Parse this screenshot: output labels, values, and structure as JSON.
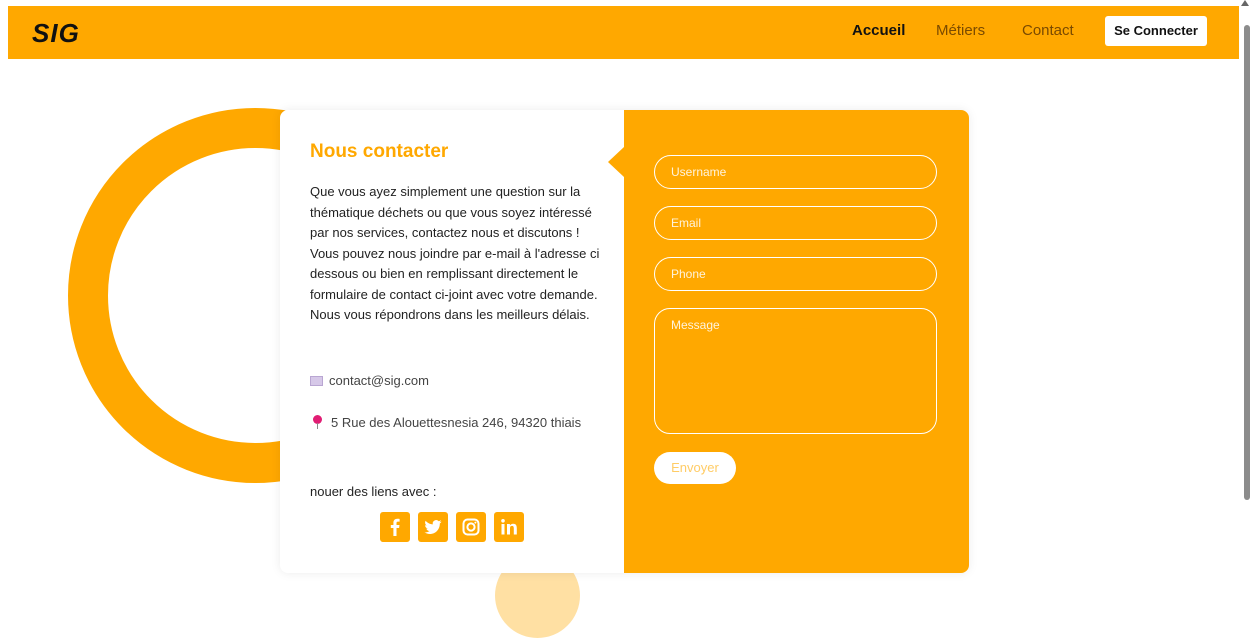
{
  "header": {
    "logo": "SIG",
    "nav": [
      {
        "label": "Accueil"
      },
      {
        "label": "Métiers"
      },
      {
        "label": "Contact"
      }
    ],
    "login_label": "Se Connecter"
  },
  "contact": {
    "title": "Nous contacter",
    "description": "Que vous ayez simplement une question sur la thématique déchets ou que vous soyez intéressé par nos services, contactez nous et discutons ! Vous pouvez nous joindre par e-mail à l'adresse ci dessous ou bien en remplissant directement le formulaire de contact ci-joint avec votre demande. Nous vous répondrons dans les meilleurs délais.",
    "email": "contact@sig.com",
    "address": "5 Rue des Alouettesnesia 246, 94320 thiais",
    "social_label": "nouer des liens avec :",
    "social_icons": [
      "facebook-icon",
      "twitter-icon",
      "instagram-icon",
      "linkedin-icon"
    ]
  },
  "form": {
    "username_placeholder": "Username",
    "email_placeholder": "Email",
    "phone_placeholder": "Phone",
    "message_placeholder": "Message",
    "submit_label": "Envoyer"
  },
  "colors": {
    "accent": "#ffa800",
    "background": "#ffffff"
  }
}
